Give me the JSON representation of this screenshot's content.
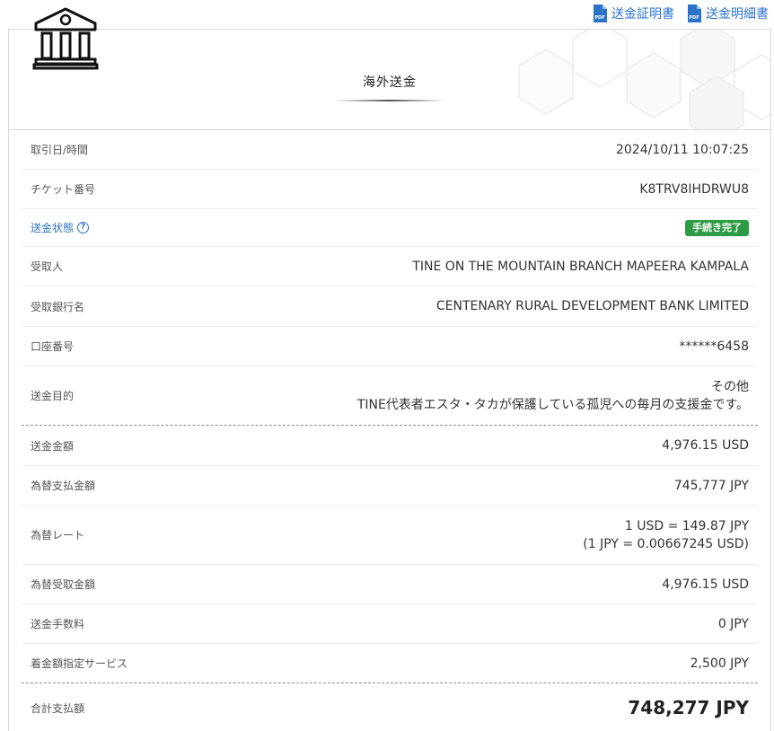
{
  "links": {
    "certificate": "送金証明書",
    "statement": "送金明細書"
  },
  "header": {
    "title": "海外送金"
  },
  "rows": {
    "datetime": {
      "label": "取引日/時間",
      "value": "2024/10/11 10:07:25"
    },
    "ticket": {
      "label": "チケット番号",
      "value": "K8TRV8IHDRWU8"
    },
    "status": {
      "label": "送金状態",
      "badge": "手続き完了",
      "help": "?"
    },
    "recipient": {
      "label": "受取人",
      "value": "TINE ON THE MOUNTAIN BRANCH MAPEERA KAMPALA"
    },
    "bank": {
      "label": "受取銀行名",
      "value": "CENTENARY RURAL DEVELOPMENT BANK LIMITED"
    },
    "account": {
      "label": "口座番号",
      "value": "******6458"
    },
    "purpose": {
      "label": "送金目的",
      "line1": "その他",
      "line2": "TINE代表者エスタ・タカが保護している孤児への毎月の支援金です。"
    },
    "send_amount": {
      "label": "送金金額",
      "value": "4,976.15 USD"
    },
    "fx_payment": {
      "label": "為替支払金額",
      "value": "745,777 JPY"
    },
    "fx_rate": {
      "label": "為替レート",
      "line1": "1 USD = 149.87 JPY",
      "line2": "(1 JPY = 0.00667245 USD)"
    },
    "fx_receive": {
      "label": "為替受取金額",
      "value": "4,976.15 USD"
    },
    "fee": {
      "label": "送金手数料",
      "value": "0 JPY"
    },
    "service": {
      "label": "着金額指定サービス",
      "value": "2,500 JPY"
    },
    "total": {
      "label": "合計支払額",
      "value": "748,277 JPY"
    }
  },
  "colors": {
    "link": "#2b73c9",
    "badge": "#2e9b45"
  },
  "icons": [
    "pdf-icon",
    "bank-icon",
    "help-circle-icon"
  ]
}
